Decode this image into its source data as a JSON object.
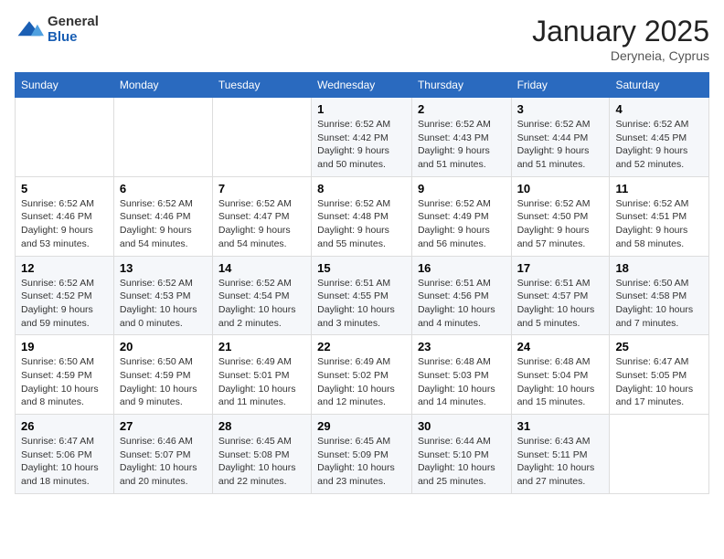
{
  "logo": {
    "general": "General",
    "blue": "Blue"
  },
  "title": "January 2025",
  "subtitle": "Deryneia, Cyprus",
  "days_of_week": [
    "Sunday",
    "Monday",
    "Tuesday",
    "Wednesday",
    "Thursday",
    "Friday",
    "Saturday"
  ],
  "weeks": [
    [
      {
        "num": "",
        "info": ""
      },
      {
        "num": "",
        "info": ""
      },
      {
        "num": "",
        "info": ""
      },
      {
        "num": "1",
        "info": "Sunrise: 6:52 AM\nSunset: 4:42 PM\nDaylight: 9 hours\nand 50 minutes."
      },
      {
        "num": "2",
        "info": "Sunrise: 6:52 AM\nSunset: 4:43 PM\nDaylight: 9 hours\nand 51 minutes."
      },
      {
        "num": "3",
        "info": "Sunrise: 6:52 AM\nSunset: 4:44 PM\nDaylight: 9 hours\nand 51 minutes."
      },
      {
        "num": "4",
        "info": "Sunrise: 6:52 AM\nSunset: 4:45 PM\nDaylight: 9 hours\nand 52 minutes."
      }
    ],
    [
      {
        "num": "5",
        "info": "Sunrise: 6:52 AM\nSunset: 4:46 PM\nDaylight: 9 hours\nand 53 minutes."
      },
      {
        "num": "6",
        "info": "Sunrise: 6:52 AM\nSunset: 4:46 PM\nDaylight: 9 hours\nand 54 minutes."
      },
      {
        "num": "7",
        "info": "Sunrise: 6:52 AM\nSunset: 4:47 PM\nDaylight: 9 hours\nand 54 minutes."
      },
      {
        "num": "8",
        "info": "Sunrise: 6:52 AM\nSunset: 4:48 PM\nDaylight: 9 hours\nand 55 minutes."
      },
      {
        "num": "9",
        "info": "Sunrise: 6:52 AM\nSunset: 4:49 PM\nDaylight: 9 hours\nand 56 minutes."
      },
      {
        "num": "10",
        "info": "Sunrise: 6:52 AM\nSunset: 4:50 PM\nDaylight: 9 hours\nand 57 minutes."
      },
      {
        "num": "11",
        "info": "Sunrise: 6:52 AM\nSunset: 4:51 PM\nDaylight: 9 hours\nand 58 minutes."
      }
    ],
    [
      {
        "num": "12",
        "info": "Sunrise: 6:52 AM\nSunset: 4:52 PM\nDaylight: 9 hours\nand 59 minutes."
      },
      {
        "num": "13",
        "info": "Sunrise: 6:52 AM\nSunset: 4:53 PM\nDaylight: 10 hours\nand 0 minutes."
      },
      {
        "num": "14",
        "info": "Sunrise: 6:52 AM\nSunset: 4:54 PM\nDaylight: 10 hours\nand 2 minutes."
      },
      {
        "num": "15",
        "info": "Sunrise: 6:51 AM\nSunset: 4:55 PM\nDaylight: 10 hours\nand 3 minutes."
      },
      {
        "num": "16",
        "info": "Sunrise: 6:51 AM\nSunset: 4:56 PM\nDaylight: 10 hours\nand 4 minutes."
      },
      {
        "num": "17",
        "info": "Sunrise: 6:51 AM\nSunset: 4:57 PM\nDaylight: 10 hours\nand 5 minutes."
      },
      {
        "num": "18",
        "info": "Sunrise: 6:50 AM\nSunset: 4:58 PM\nDaylight: 10 hours\nand 7 minutes."
      }
    ],
    [
      {
        "num": "19",
        "info": "Sunrise: 6:50 AM\nSunset: 4:59 PM\nDaylight: 10 hours\nand 8 minutes."
      },
      {
        "num": "20",
        "info": "Sunrise: 6:50 AM\nSunset: 4:59 PM\nDaylight: 10 hours\nand 9 minutes."
      },
      {
        "num": "21",
        "info": "Sunrise: 6:49 AM\nSunset: 5:01 PM\nDaylight: 10 hours\nand 11 minutes."
      },
      {
        "num": "22",
        "info": "Sunrise: 6:49 AM\nSunset: 5:02 PM\nDaylight: 10 hours\nand 12 minutes."
      },
      {
        "num": "23",
        "info": "Sunrise: 6:48 AM\nSunset: 5:03 PM\nDaylight: 10 hours\nand 14 minutes."
      },
      {
        "num": "24",
        "info": "Sunrise: 6:48 AM\nSunset: 5:04 PM\nDaylight: 10 hours\nand 15 minutes."
      },
      {
        "num": "25",
        "info": "Sunrise: 6:47 AM\nSunset: 5:05 PM\nDaylight: 10 hours\nand 17 minutes."
      }
    ],
    [
      {
        "num": "26",
        "info": "Sunrise: 6:47 AM\nSunset: 5:06 PM\nDaylight: 10 hours\nand 18 minutes."
      },
      {
        "num": "27",
        "info": "Sunrise: 6:46 AM\nSunset: 5:07 PM\nDaylight: 10 hours\nand 20 minutes."
      },
      {
        "num": "28",
        "info": "Sunrise: 6:45 AM\nSunset: 5:08 PM\nDaylight: 10 hours\nand 22 minutes."
      },
      {
        "num": "29",
        "info": "Sunrise: 6:45 AM\nSunset: 5:09 PM\nDaylight: 10 hours\nand 23 minutes."
      },
      {
        "num": "30",
        "info": "Sunrise: 6:44 AM\nSunset: 5:10 PM\nDaylight: 10 hours\nand 25 minutes."
      },
      {
        "num": "31",
        "info": "Sunrise: 6:43 AM\nSunset: 5:11 PM\nDaylight: 10 hours\nand 27 minutes."
      },
      {
        "num": "",
        "info": ""
      }
    ]
  ]
}
